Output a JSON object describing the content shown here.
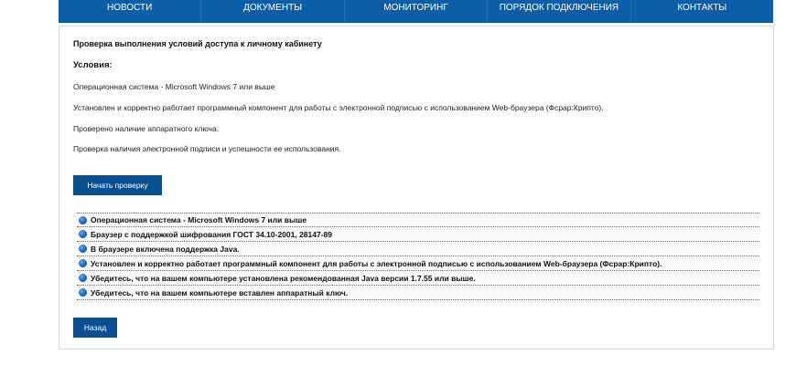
{
  "nav": {
    "items": [
      {
        "label": "НОВОСТИ"
      },
      {
        "label": "ДОКУМЕНТЫ"
      },
      {
        "label": "МОНИТОРИНГ"
      },
      {
        "label": "ПОРЯДОК ПОДКЛЮЧЕНИЯ"
      },
      {
        "label": "КОНТАКТЫ"
      }
    ]
  },
  "main": {
    "title": "Проверка выполнения условий доступа к личному кабинету",
    "conditions_heading": "Условия:",
    "conditions": [
      "Операционная система - Microsoft Windows 7 или выше",
      "Установлен и корректно работает программный компонент для работы с электронной подписью с использованием Web-браузера (Фсрар:Крипто).",
      "Проверено наличие аппаратного ключа.",
      "Проверка наличия электронной подписи и успешности ее использования."
    ],
    "start_button_label": "Начать проверку",
    "checks": [
      "Операционная система - Microsoft Windows 7 или выше",
      "Браузер с поддержкой шифрования ГОСТ 34.10-2001, 28147-89",
      "В браузере включена поддержка Java.",
      "Установлен и корректно работает программный компонент для работы с электронной подписью с использованием Web-браузера (Фсрар:Крипто).",
      "Убедитесь, что на вашем компьютере установлена рекомендованная Java версии 1.7.55 или выше.",
      "Убедитесь, что на вашем компьютере вставлен аппаратный ключ."
    ],
    "check_icon": "blue-circle-icon",
    "back_button_label": "Назад"
  },
  "colors": {
    "nav_background": "#0a5fa8",
    "button_background": "#0a4f8e",
    "check_icon": "#1a66c0"
  }
}
